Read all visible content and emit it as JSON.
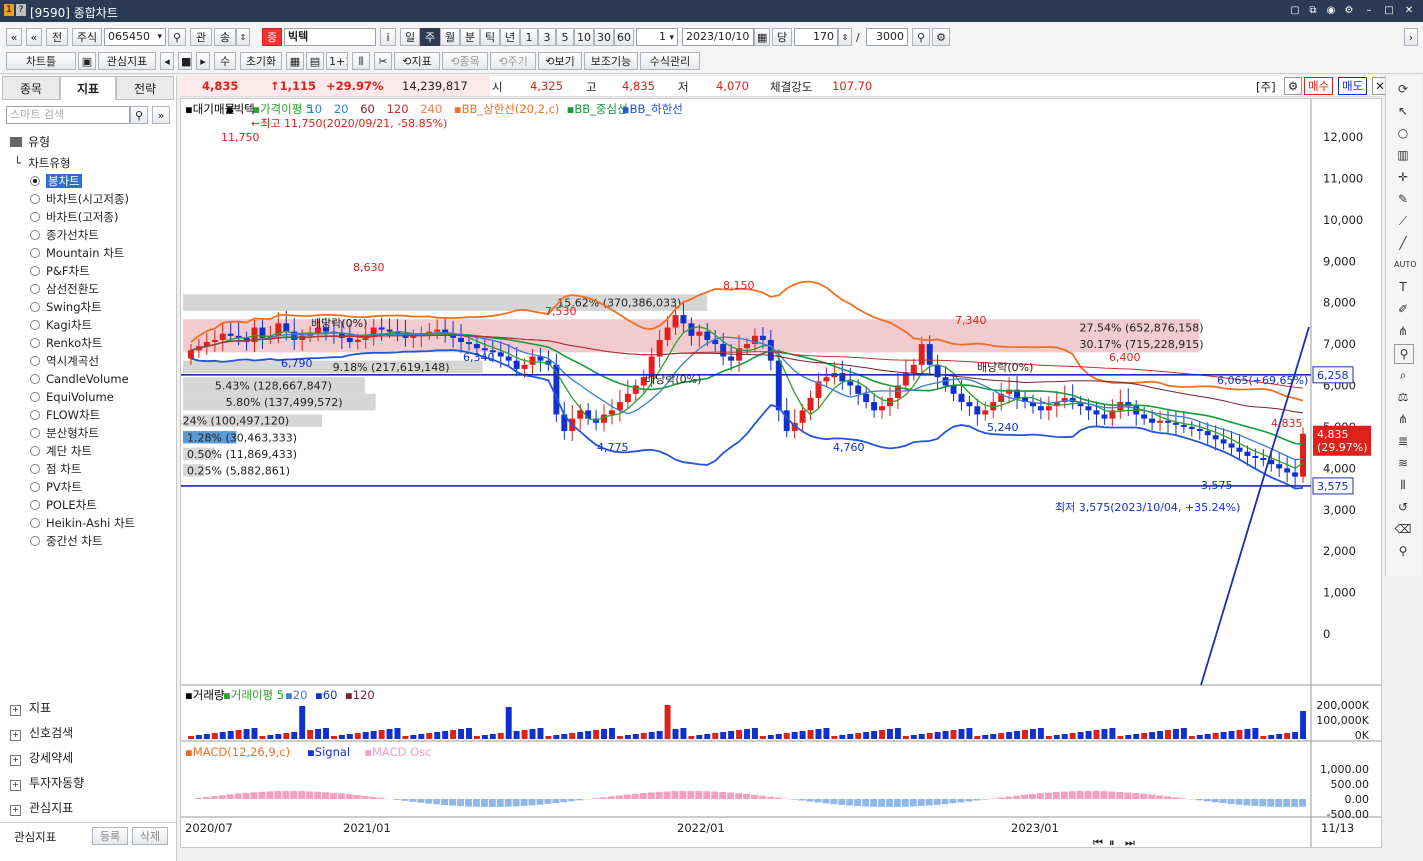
{
  "window": {
    "title": "[9590] 종합차트",
    "icons": [
      "new-window-icon",
      "copy-icon",
      "link-icon",
      "camera-icon",
      "gear-icon",
      "minimize-icon",
      "maximize-icon",
      "close-icon"
    ]
  },
  "toolbar1": {
    "nav_prev": "«",
    "nav_up": "«",
    "all_label": "전",
    "market_label": "주식",
    "code": "065450",
    "rel_label": "관",
    "up_label": "송",
    "jeung": "증",
    "stock_name": "빅텍",
    "info_label": "i",
    "periods": [
      "일",
      "주",
      "월",
      "분",
      "틱",
      "년"
    ],
    "active_period": "주",
    "intervals": [
      "1",
      "3",
      "5",
      "10",
      "30",
      "60"
    ],
    "count_small": "1",
    "date": "2023/10/10",
    "dang_label": "당",
    "bars": "170",
    "slash": "/",
    "max": "3000"
  },
  "toolbar2": {
    "chart_type_btn": "차트틀",
    "watch_indicator": "관심지표",
    "su_label": "수",
    "reset": "초기화",
    "one_plus_one": "1+1",
    "indicator": "지표",
    "item": "종목",
    "period": "주기",
    "view": "보기",
    "aux": "보조기능",
    "formula": "수식관리"
  },
  "left": {
    "tabs": [
      "종목",
      "지표",
      "전략"
    ],
    "active_tab": "지표",
    "search_placeholder": "스마트 검색",
    "section_type": "유형",
    "tree_parent": "차트유형",
    "chart_types": [
      "봉차트",
      "바차트(시고저종)",
      "바차트(고저종)",
      "종가선차트",
      "Mountain 차트",
      "P&F차트",
      "삼선전환도",
      "Swing차트",
      "Kagi차트",
      "Renko차트",
      "역시계곡선",
      "CandleVolume",
      "EquiVolume",
      "FLOW차트",
      "분산형차트",
      "계단 차트",
      "점 차트",
      "PV차트",
      "POLE차트",
      "Heikin-Ashi 차트",
      "중간선 차트"
    ],
    "selected": "봉차트",
    "bottom_sections": [
      "지표",
      "신호검색",
      "강세약세",
      "투자자동향",
      "관심지표"
    ],
    "footer_label": "관심지표",
    "register": "등록",
    "delete": "삭제"
  },
  "quote": {
    "price": "4,835",
    "change": "↑1,115",
    "rate": "+29.97%",
    "volume": "14,239,817",
    "open_label": "시",
    "open": "4,325",
    "high_label": "고",
    "high": "4,835",
    "low_label": "저",
    "low": "4,070",
    "strength_label": "체결강도",
    "strength": "107.70",
    "ju": "[주]",
    "buy": "매수",
    "sell": "매도"
  },
  "colors": {
    "up": "#e0201a",
    "down": "#1030d0",
    "ma5": "#2ca02c",
    "ma10": "#3a7bd5",
    "bb_upper": "#f07020",
    "bb_mid": "#169a3a",
    "bb_lower": "#2455d8",
    "ma60": "#7a2030",
    "ma120": "#c03030",
    "ma240": "#f08050"
  },
  "chart_data": {
    "type": "candlestick",
    "legend": [
      {
        "name": "대기매물",
        "color": "#000"
      },
      {
        "name": "빅텍",
        "color": "#000"
      },
      {
        "name": "가격이평 5",
        "color": "#2ca02c"
      },
      {
        "name": "10",
        "color": "#3a7bd5"
      },
      {
        "name": "20",
        "color": "#3a7bd5"
      },
      {
        "name": "60",
        "color": "#7a2030"
      },
      {
        "name": "120",
        "color": "#c03030"
      },
      {
        "name": "240",
        "color": "#f08050"
      },
      {
        "name": "BB_상한선(20,2,c)",
        "color": "#f07020"
      },
      {
        "name": "BB_중심선",
        "color": "#169a3a"
      },
      {
        "name": "BB_하한선",
        "color": "#2455d8"
      }
    ],
    "y_ticks": [
      "12,000",
      "11,000",
      "10,000",
      "9,000",
      "8,000",
      "7,000",
      "6,000",
      "5,000",
      "4,000",
      "3,000",
      "2,000",
      "1,000",
      "0"
    ],
    "ylim": [
      0,
      12000
    ],
    "x_labels": [
      "2020/07",
      "2021/01",
      "2022/01",
      "2023/01",
      "11/13"
    ],
    "annotations": [
      {
        "text": "←최고 11,750(2020/09/21, -58.85%)"
      },
      {
        "text": "11,750"
      },
      {
        "text": "8,630"
      },
      {
        "text": "8,150"
      },
      {
        "text": "7,530"
      },
      {
        "text": "7,340"
      },
      {
        "text": "6,400"
      },
      {
        "text": "6,790"
      },
      {
        "text": "6,340"
      },
      {
        "text": "4,775"
      },
      {
        "text": "4,760"
      },
      {
        "text": "5,240"
      },
      {
        "text": "4,835"
      },
      {
        "text": "3,575"
      },
      {
        "text": "배당락(0%)"
      },
      {
        "text": "배당락(0%)"
      },
      {
        "text": "배당락(0%)"
      },
      {
        "text": "6,065(+69.65%)"
      },
      {
        "text": "최저 3,575(2023/10/04, +35.24%)"
      }
    ],
    "volume_profile": [
      {
        "label": "15.62% (370,386,033)",
        "price_lo": 7800,
        "price_hi": 8200
      },
      {
        "label": "27.54% (652,876,158)",
        "price_lo": 7200,
        "price_hi": 7600
      },
      {
        "label": "30.17% (715,228,915)",
        "price_lo": 6800,
        "price_hi": 7200
      },
      {
        "label": "9.18% (217,619,148)",
        "price_lo": 6300,
        "price_hi": 6600
      },
      {
        "label": "5.43% (128,667,847)",
        "price_lo": 5800,
        "price_hi": 6200
      },
      {
        "label": "5.80% (137,499,572)",
        "price_lo": 5400,
        "price_hi": 5800
      },
      {
        "label": "4.24% (100,497,120)",
        "price_lo": 5000,
        "price_hi": 5300
      },
      {
        "label": "1.28% (30,463,333)",
        "price_lo": 4600,
        "price_hi": 4900
      },
      {
        "label": "0.50% (11,869,433)",
        "price_lo": 4200,
        "price_hi": 4500
      },
      {
        "label": "0.25% (5,882,861)",
        "price_lo": 3800,
        "price_hi": 4100
      }
    ],
    "hlines": [
      {
        "label": "6,258",
        "value": 6258
      },
      {
        "label": "3,575",
        "value": 3575
      }
    ],
    "current_label": "4,835",
    "current_rate": "(29.97%)",
    "closes": [
      6850,
      6950,
      7050,
      7100,
      7250,
      7200,
      7150,
      7050,
      7400,
      7150,
      7200,
      7500,
      7300,
      7100,
      7200,
      7250,
      7400,
      7300,
      7250,
      7150,
      7050,
      7100,
      7200,
      7400,
      7350,
      7300,
      7250,
      7150,
      7200,
      7250,
      7300,
      7350,
      7250,
      7150,
      7050,
      7000,
      6900,
      6850,
      6800,
      6700,
      6600,
      6400,
      6500,
      6700,
      6600,
      6500,
      5300,
      4900,
      5200,
      5400,
      5200,
      5100,
      5300,
      5400,
      5600,
      5800,
      6000,
      6200,
      6700,
      7100,
      7400,
      7700,
      7500,
      7200,
      7300,
      7100,
      7000,
      6700,
      6600,
      6900,
      7000,
      7200,
      7100,
      6600,
      5400,
      4900,
      5100,
      5400,
      5700,
      6100,
      6200,
      6300,
      6100,
      6000,
      5800,
      5600,
      5400,
      5500,
      5700,
      6000,
      6300,
      6500,
      7000,
      6500,
      6200,
      6000,
      5800,
      5600,
      5500,
      5300,
      5400,
      5600,
      5800,
      5900,
      5700,
      5600,
      5500,
      5400,
      5500,
      5600,
      5700,
      5600,
      5500,
      5400,
      5300,
      5200,
      5400,
      5600,
      5500,
      5300,
      5200,
      5100,
      5150,
      5100,
      5050,
      5000,
      4950,
      4900,
      4800,
      4700,
      4600,
      4500,
      4400,
      4300,
      4250,
      4200,
      4100,
      4000,
      3900,
      3800,
      4835
    ]
  },
  "volume_pane": {
    "legend": [
      "거래량",
      "거래이평 5",
      "20",
      "60",
      "120"
    ],
    "y_ticks": [
      "200,000K",
      "100,000K",
      "0K"
    ]
  },
  "macd_pane": {
    "legend": [
      "MACD(12,26,9,c)",
      "Signal",
      "MACD Osc"
    ],
    "y_ticks": [
      "1,000.00",
      "500.00",
      "0.00",
      "-500.00"
    ]
  }
}
